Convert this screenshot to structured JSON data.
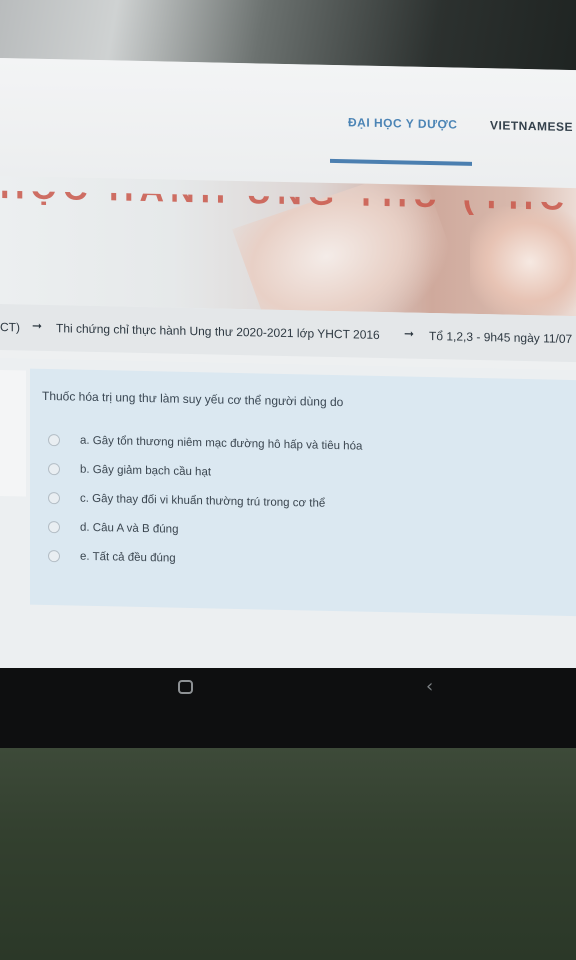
{
  "nav": {
    "school": "ĐẠI HỌC Y DƯỢC",
    "language": "VIETNAMESE"
  },
  "banner": {
    "title_partial": "HỌC HÀNH UNG THƯ (YHCT)"
  },
  "breadcrumb": {
    "items": [
      "CT)",
      "Thi chứng chỉ thực hành Ung thư 2020-2021 lớp YHCT 2016",
      "Tổ 1,2,3 - 9h45 ngày 11/07"
    ],
    "separator": "➞"
  },
  "quiz": {
    "question": "Thuốc hóa trị ung thư làm suy yếu cơ thể người dùng do",
    "options": [
      "a. Gây tổn thương niêm mạc đường hô hấp và tiêu hóa",
      "b. Gây giảm bạch cầu hạt",
      "c. Gây thay đổi vi khuẩn thường trú trong cơ thể",
      "d. Câu A và B đúng",
      "e. Tất cả đều đúng"
    ]
  },
  "android_nav": {
    "home_icon": "home-square-icon",
    "back_icon": "back-chevron-icon",
    "back_glyph": "‹"
  },
  "colors": {
    "accent": "#4b84b5",
    "question_box": "#dbe8f1"
  }
}
